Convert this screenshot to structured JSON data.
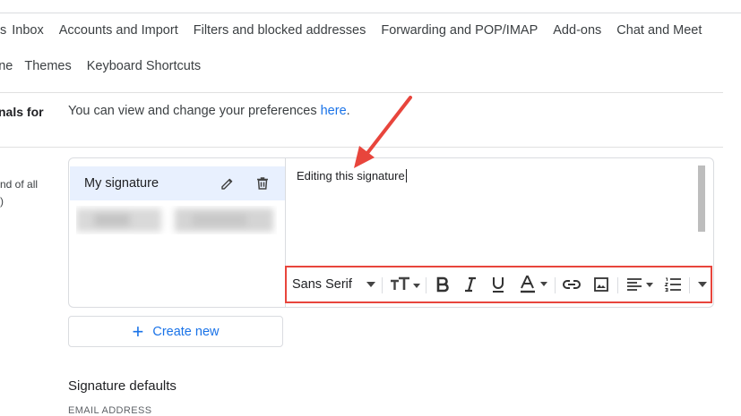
{
  "tabs_row1": [
    "Inbox",
    "Accounts and Import",
    "Filters and blocked addresses",
    "Forwarding and POP/IMAP",
    "Add-ons",
    "Chat and Meet"
  ],
  "tabs_row1_partial": "s",
  "tabs_row2_partial": "ine",
  "tabs_row2": [
    "Themes",
    "Keyboard Shortcuts"
  ],
  "left_label": "nals for",
  "left_small_1": "nd of all",
  "left_small_2": ")",
  "prefs_text": "You can view and change your preferences ",
  "prefs_link": "here",
  "prefs_period": ".",
  "signature": {
    "name": "My signature",
    "editor_text": "Editing this signature"
  },
  "toolbar": {
    "font": "Sans Serif",
    "buttons": [
      "font-size",
      "bold",
      "italic",
      "underline",
      "text-color",
      "link",
      "image",
      "align",
      "numbered-list",
      "more"
    ]
  },
  "create_new_label": "Create new",
  "signature_defaults_title": "Signature defaults",
  "email_address_label": "EMAIL ADDRESS",
  "colors": {
    "accent": "#1a73e8",
    "highlight": "#e8f0fe",
    "annotation": "#e8453c"
  }
}
